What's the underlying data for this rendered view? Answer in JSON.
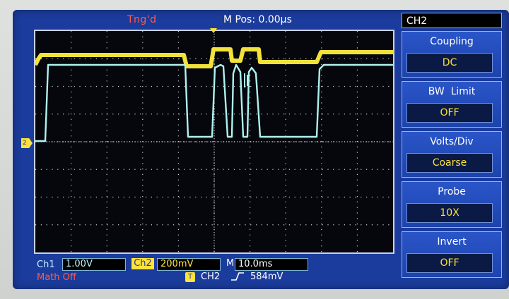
{
  "header": {
    "trigger_status": "Tng'd",
    "main_position": "M Pos: 0.00μs"
  },
  "menu": {
    "title": "CH2",
    "items": [
      {
        "label": "Coupling",
        "value": "DC"
      },
      {
        "label": "BW  Limit",
        "value": "OFF"
      },
      {
        "label": "Volts/Div",
        "value": "Coarse"
      },
      {
        "label": "Probe",
        "value": "10X"
      },
      {
        "label": "Invert",
        "value": "OFF"
      }
    ]
  },
  "footer": {
    "ch1_label": "Ch1",
    "ch1_scale": "1.00V",
    "ch2_label": "Ch2",
    "ch2_scale": "200mV",
    "time_label": "M",
    "time_scale": "10.0ms",
    "math_status": "Math Off",
    "trigger_badge": "T",
    "trigger_source": "CH2",
    "trigger_level": "584mV"
  },
  "markers": {
    "ground_marker": "2"
  },
  "colors": {
    "ch1_trace": "#aef2f0",
    "ch2_trace": "#ffee3c",
    "screen_bg": "#1b3c9c",
    "grid_bg": "#05070c",
    "accent_red": "#ff5a4a"
  },
  "icons": {
    "edge": "rising-edge-icon",
    "trigger_position": "triangle-down-icon"
  }
}
